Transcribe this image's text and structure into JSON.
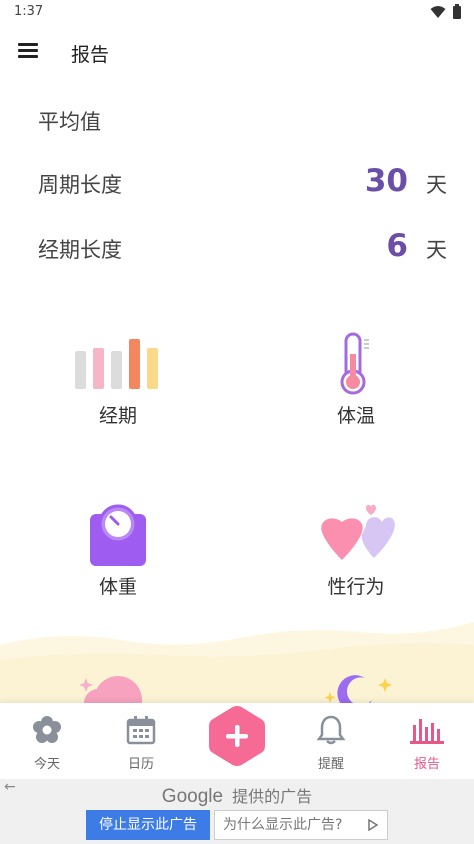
{
  "status_bar": {
    "time": "1:37"
  },
  "app_bar": {
    "title": "报告"
  },
  "averages": {
    "title": "平均值",
    "cycle": {
      "label": "周期长度",
      "value": "30",
      "unit": "天"
    },
    "period": {
      "label": "经期长度",
      "value": "6",
      "unit": "天"
    }
  },
  "categories": [
    {
      "label": "经期",
      "icon": "period-bars-icon"
    },
    {
      "label": "体温",
      "icon": "thermometer-icon"
    },
    {
      "label": "体重",
      "icon": "scale-icon"
    },
    {
      "label": "性行为",
      "icon": "hearts-icon"
    }
  ],
  "bottom_nav": {
    "items": [
      {
        "label": "今天",
        "icon": "flower-icon"
      },
      {
        "label": "日历",
        "icon": "calendar-icon"
      },
      {
        "label": "提醒",
        "icon": "bell-icon"
      },
      {
        "label": "报告",
        "icon": "bar-chart-icon",
        "active": true
      }
    ],
    "fab_icon": "plus-icon"
  },
  "ad": {
    "google": "Google",
    "provided": "提供的广告",
    "stop": "停止显示此广告",
    "why": "为什么显示此广告?"
  },
  "colors": {
    "accent_purple": "#6b4ea8",
    "accent_pink": "#e8578a",
    "ad_button_blue": "#3d7ce6"
  }
}
